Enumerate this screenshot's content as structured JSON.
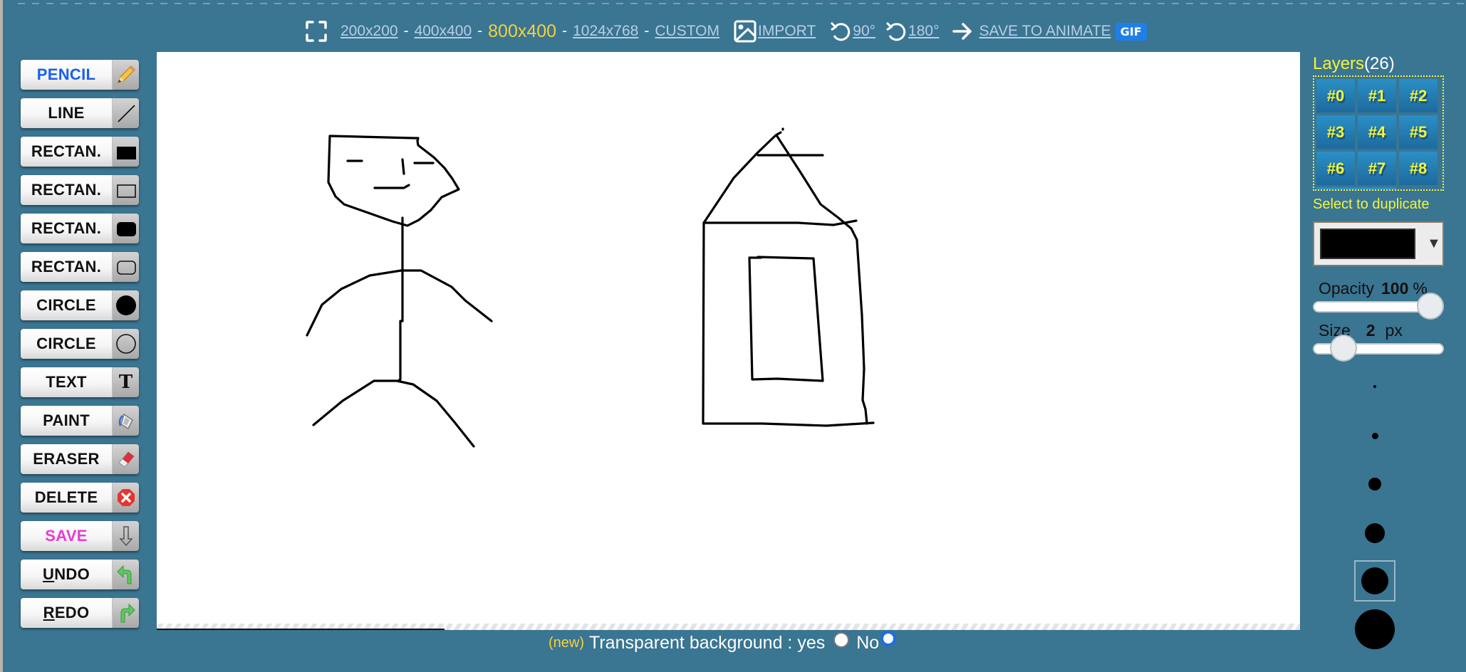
{
  "toolbar": {
    "fullscreen_icon": "fullscreen-corners-icon",
    "sizes": [
      {
        "label": "200x200",
        "active": false
      },
      {
        "label": "400x400",
        "active": false
      },
      {
        "label": "800x400",
        "active": true
      },
      {
        "label": "1024x768",
        "active": false
      },
      {
        "label": "CUSTOM",
        "active": false
      }
    ],
    "separator": "-",
    "import_label": "IMPORT",
    "rotate90_label": "90°",
    "rotate180_label": "180°",
    "save_animate_label": "SAVE TO ANIMATE",
    "gif_badge": "GIF"
  },
  "tools": [
    {
      "label": "PENCIL",
      "icon": "pencil-icon",
      "color": "#1a5ff0",
      "active": true
    },
    {
      "label": "LINE",
      "icon": "line-icon",
      "color": "#111111"
    },
    {
      "label": "RECTAN.",
      "icon": "filled-rectangle-icon",
      "color": "#111111"
    },
    {
      "label": "RECTAN.",
      "icon": "outline-rectangle-icon",
      "color": "#111111"
    },
    {
      "label": "RECTAN.",
      "icon": "filled-rounded-rectangle-icon",
      "color": "#111111"
    },
    {
      "label": "RECTAN.",
      "icon": "outline-rounded-rectangle-icon",
      "color": "#111111"
    },
    {
      "label": "CIRCLE",
      "icon": "filled-circle-icon",
      "color": "#111111"
    },
    {
      "label": "CIRCLE",
      "icon": "outline-circle-icon",
      "color": "#111111"
    },
    {
      "label": "TEXT",
      "icon": "text-t-icon",
      "color": "#111111"
    },
    {
      "label": "PAINT",
      "icon": "paint-bucket-icon",
      "color": "#111111"
    },
    {
      "label": "ERASER",
      "icon": "eraser-icon",
      "color": "#111111"
    },
    {
      "label": "DELETE",
      "icon": "delete-x-icon",
      "color": "#111111"
    },
    {
      "label": "SAVE",
      "icon": "download-arrow-icon",
      "color": "#e83ad4"
    },
    {
      "label": "UNDO",
      "icon": "undo-arrow-icon",
      "color": "#111111",
      "underline_first": true
    },
    {
      "label": "REDO",
      "icon": "redo-arrow-icon",
      "color": "#111111",
      "underline_first": true
    }
  ],
  "canvas": {
    "drawings": [
      "stick-figure",
      "house"
    ]
  },
  "footer": {
    "new_tag": "(new)",
    "transparent_label": "Transparent background : yes",
    "no_label": "No",
    "transparent_value": "No"
  },
  "layers": {
    "title": "Layers",
    "count": "(26)",
    "buttons": [
      "#0",
      "#1",
      "#2",
      "#3",
      "#4",
      "#5",
      "#6",
      "#7",
      "#8"
    ],
    "duplicate_hint": "Select to duplicate"
  },
  "color": {
    "selected": "#000000",
    "dropdown_icon": "triangle-down-icon"
  },
  "opacity": {
    "label": "Opacity",
    "value": "100",
    "unit": "%",
    "fraction": 1.0
  },
  "size": {
    "label": "Size",
    "value": "2",
    "unit": "px",
    "fraction": 0.14
  },
  "brush_presets": [
    {
      "name": "size-1",
      "selected": false
    },
    {
      "name": "size-2",
      "selected": false
    },
    {
      "name": "size-3",
      "selected": false
    },
    {
      "name": "size-4",
      "selected": false
    },
    {
      "name": "size-5",
      "selected": true
    },
    {
      "name": "size-6",
      "selected": false
    }
  ],
  "colors": {
    "background": "#3a7592",
    "accent_yellow": "#f4f43a",
    "active_size": "#f7d13b",
    "link": "#b7cfe6",
    "gif_badge": "#1f7fe8",
    "layer_button": "#2b8fc6"
  }
}
